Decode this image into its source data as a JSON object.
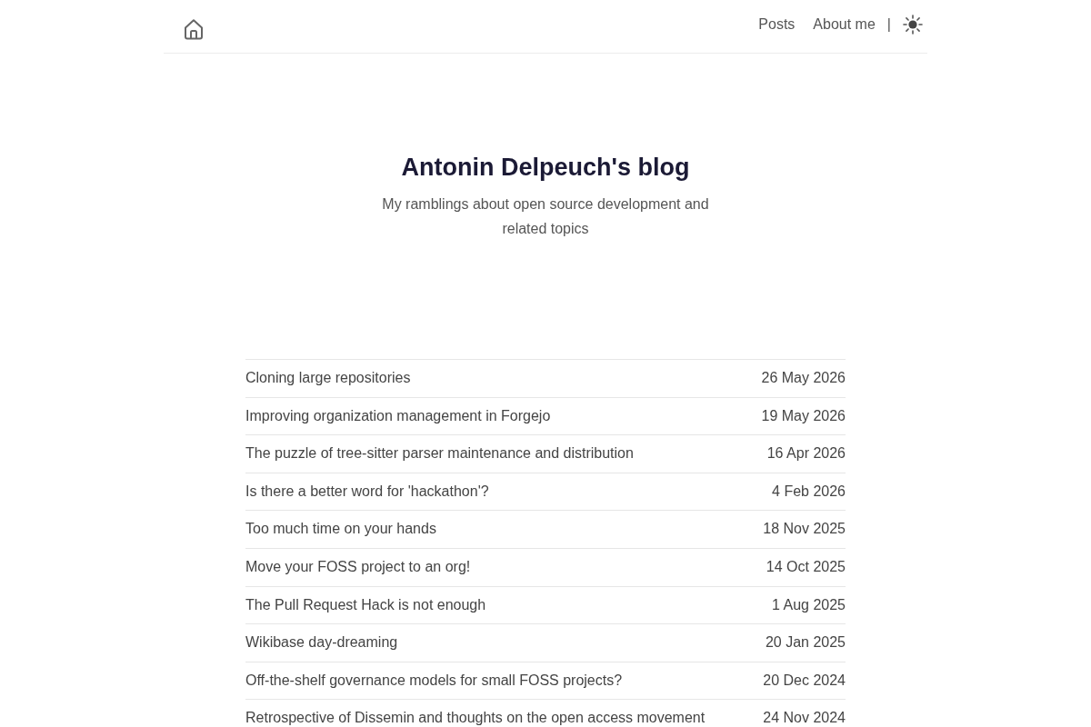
{
  "header": {
    "nav": [
      {
        "label": "Posts"
      },
      {
        "label": "About me"
      }
    ],
    "separator": "|"
  },
  "hero": {
    "title": "Antonin Delpeuch's blog",
    "subtitle": "My ramblings about open source development and related topics"
  },
  "posts": [
    {
      "title": "Cloning large repositories",
      "date": "26 May 2026"
    },
    {
      "title": "Improving organization management in Forgejo",
      "date": "19 May 2026"
    },
    {
      "title": "The puzzle of tree-sitter parser maintenance and distribution",
      "date": "16 Apr 2026"
    },
    {
      "title": "Is there a better word for 'hackathon'?",
      "date": "4 Feb 2026"
    },
    {
      "title": "Too much time on your hands",
      "date": "18 Nov 2025"
    },
    {
      "title": "Move your FOSS project to an org!",
      "date": "14 Oct 2025"
    },
    {
      "title": "The Pull Request Hack is not enough",
      "date": "1 Aug 2025"
    },
    {
      "title": "Wikibase day-dreaming",
      "date": "20 Jan 2025"
    },
    {
      "title": "Off-the-shelf governance models for small FOSS projects?",
      "date": "20 Dec 2024"
    },
    {
      "title": "Retrospective of Dissemin and thoughts on the open access movement",
      "date": "24 Nov 2024"
    }
  ]
}
